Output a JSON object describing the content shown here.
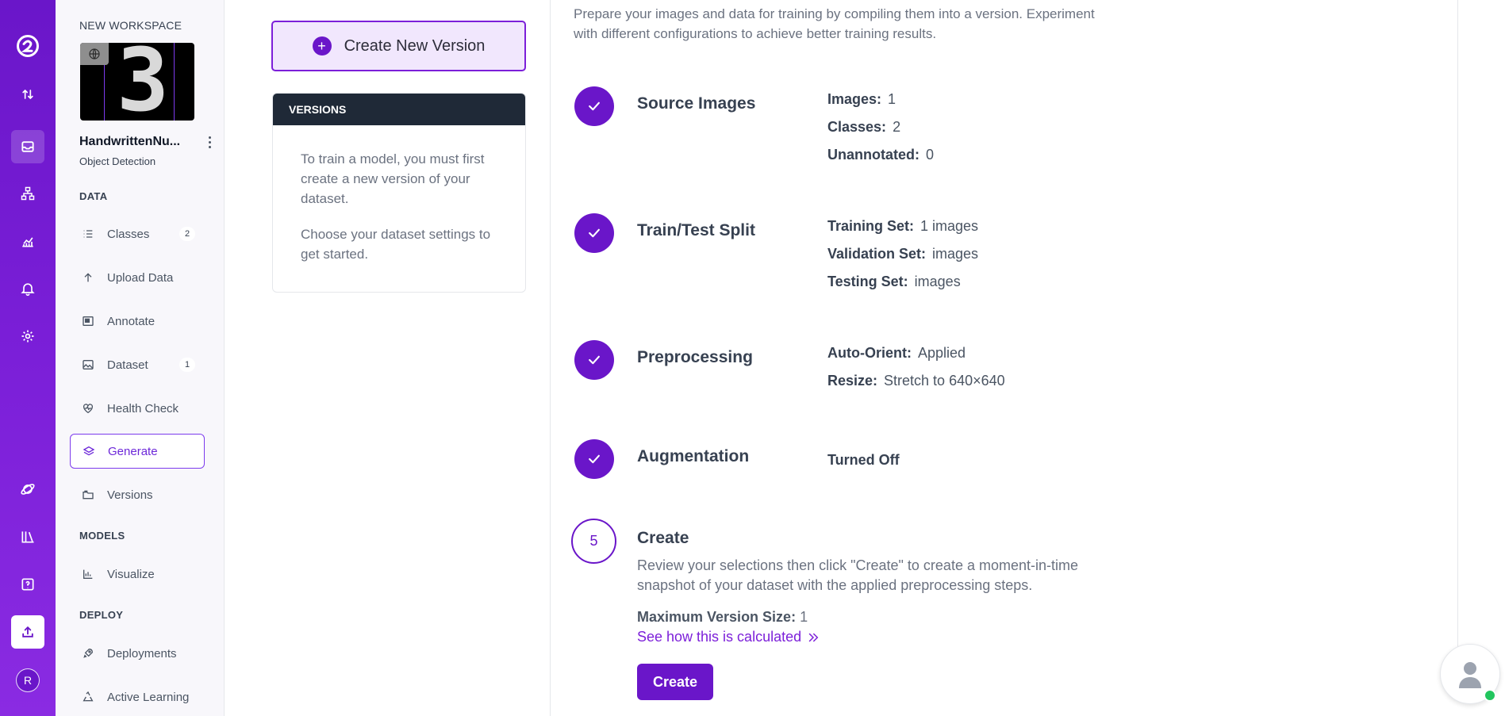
{
  "sidebar": {
    "workspace_label": "NEW WORKSPACE",
    "project_name": "HandwrittenNu...",
    "project_type": "Object Detection",
    "sections": {
      "data": "DATA",
      "models": "MODELS",
      "deploy": "DEPLOY"
    },
    "items": [
      {
        "label": "Classes",
        "badge": "2",
        "icon": "list-icon"
      },
      {
        "label": "Upload Data",
        "icon": "arrow-up-icon"
      },
      {
        "label": "Annotate",
        "icon": "annotate-icon"
      },
      {
        "label": "Dataset",
        "badge": "1",
        "icon": "image-icon"
      },
      {
        "label": "Health Check",
        "icon": "heart-pulse-icon"
      },
      {
        "label": "Generate",
        "icon": "layers-icon",
        "active": true
      },
      {
        "label": "Versions",
        "icon": "folder-icon"
      },
      {
        "label": "Visualize",
        "icon": "chart-icon"
      },
      {
        "label": "Deployments",
        "icon": "rocket-icon"
      },
      {
        "label": "Active Learning",
        "icon": "recycle-icon"
      }
    ]
  },
  "rail": {
    "avatar_initial": "R"
  },
  "versions_panel": {
    "create_new_label": "Create New Version",
    "header": "VERSIONS",
    "empty_p1": "To train a model, you must first create a new version of your dataset.",
    "empty_p2": "Choose your dataset settings to get started."
  },
  "main": {
    "intro": "Prepare your images and data for training by compiling them into a version. Experiment with different configurations to achieve better training results.",
    "steps": {
      "source": {
        "title": "Source Images",
        "fields": [
          {
            "key": "Images:",
            "value": "1"
          },
          {
            "key": "Classes:",
            "value": "2"
          },
          {
            "key": "Unannotated:",
            "value": "0"
          }
        ]
      },
      "split": {
        "title": "Train/Test Split",
        "fields": [
          {
            "key": "Training Set:",
            "value": "1 images"
          },
          {
            "key": "Validation Set:",
            "value": "images"
          },
          {
            "key": "Testing Set:",
            "value": "images"
          }
        ]
      },
      "preprocessing": {
        "title": "Preprocessing",
        "fields": [
          {
            "key": "Auto-Orient:",
            "value": "Applied"
          },
          {
            "key": "Resize:",
            "value": "Stretch to 640×640"
          }
        ]
      },
      "augmentation": {
        "title": "Augmentation",
        "status": "Turned Off"
      },
      "create": {
        "number": "5",
        "title": "Create",
        "description": "Review your selections then click \"Create\" to create a moment-in-time snapshot of your dataset with the applied preprocessing steps.",
        "max_size_label": "Maximum Version Size:",
        "max_size_value": "1",
        "calc_link": "See how this is calculated",
        "button": "Create"
      }
    }
  },
  "colors": {
    "brand": "#6a16c9",
    "brand_light": "#f1e7fd",
    "dark_header": "#1f2937"
  }
}
